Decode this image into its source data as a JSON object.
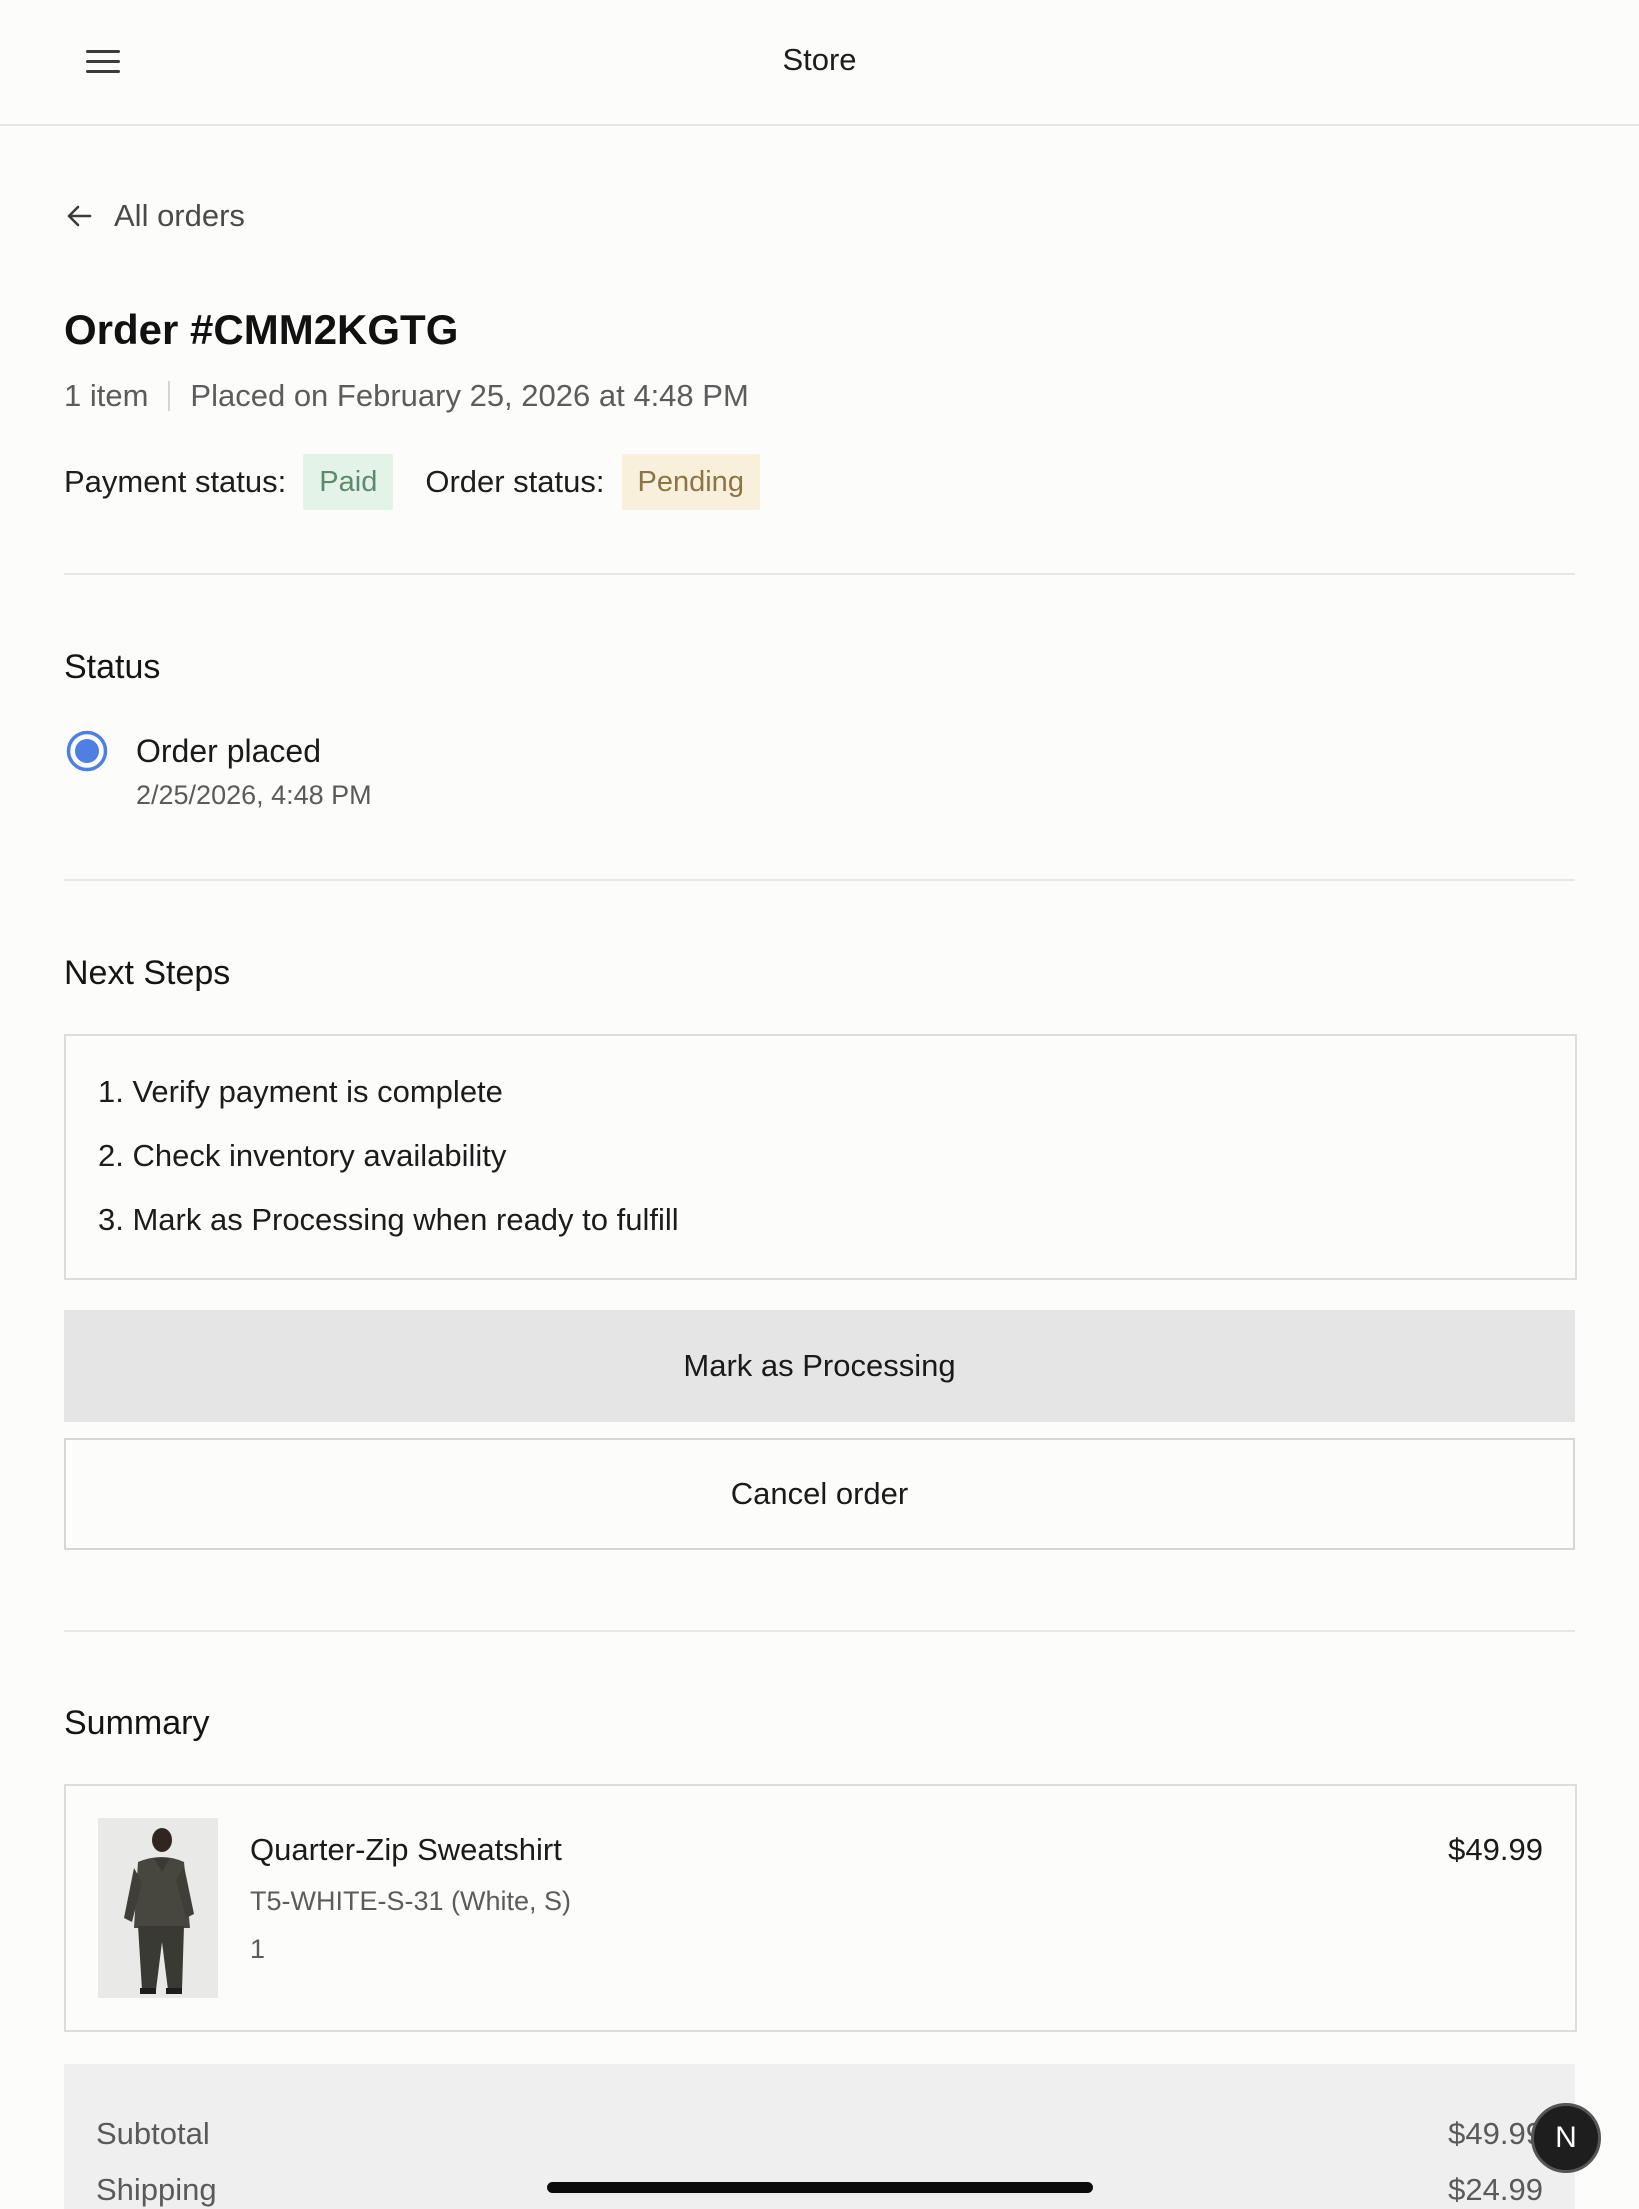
{
  "header": {
    "title": "Store",
    "menu_icon": "hamburger-menu-icon"
  },
  "nav": {
    "back_label": "All orders",
    "back_icon": "arrow-left-icon"
  },
  "order": {
    "title": "Order #CMM2KGTG",
    "item_count": "1 item",
    "placed_on": "Placed on February 25, 2026 at 4:48 PM",
    "payment_status_label": "Payment status:",
    "payment_status": "Paid",
    "order_status_label": "Order status:",
    "order_status": "Pending"
  },
  "status_section": {
    "title": "Status",
    "events": [
      {
        "label": "Order placed",
        "time": "2/25/2026, 4:48 PM",
        "icon": "radio-selected-icon"
      }
    ]
  },
  "next_steps": {
    "title": "Next Steps",
    "steps": [
      "1. Verify payment is complete",
      "2. Check inventory availability",
      "3. Mark as Processing when ready to fulfill"
    ],
    "primary_button": "Mark as Processing",
    "secondary_button": "Cancel order"
  },
  "summary": {
    "title": "Summary",
    "items": [
      {
        "name": "Quarter-Zip Sweatshirt",
        "variant": "T5-WHITE-S-31 (White, S)",
        "quantity": "1",
        "price": "$49.99"
      }
    ],
    "subtotal_label": "Subtotal",
    "subtotal": "$49.99",
    "shipping_label": "Shipping",
    "shipping": "$24.99"
  },
  "fab": {
    "label": "N"
  },
  "colors": {
    "paid_bg": "#e3f3e8",
    "pending_bg": "#f8f0da",
    "radio_accent": "#4f7fe3",
    "primary_button_bg": "#e5e5e5"
  }
}
